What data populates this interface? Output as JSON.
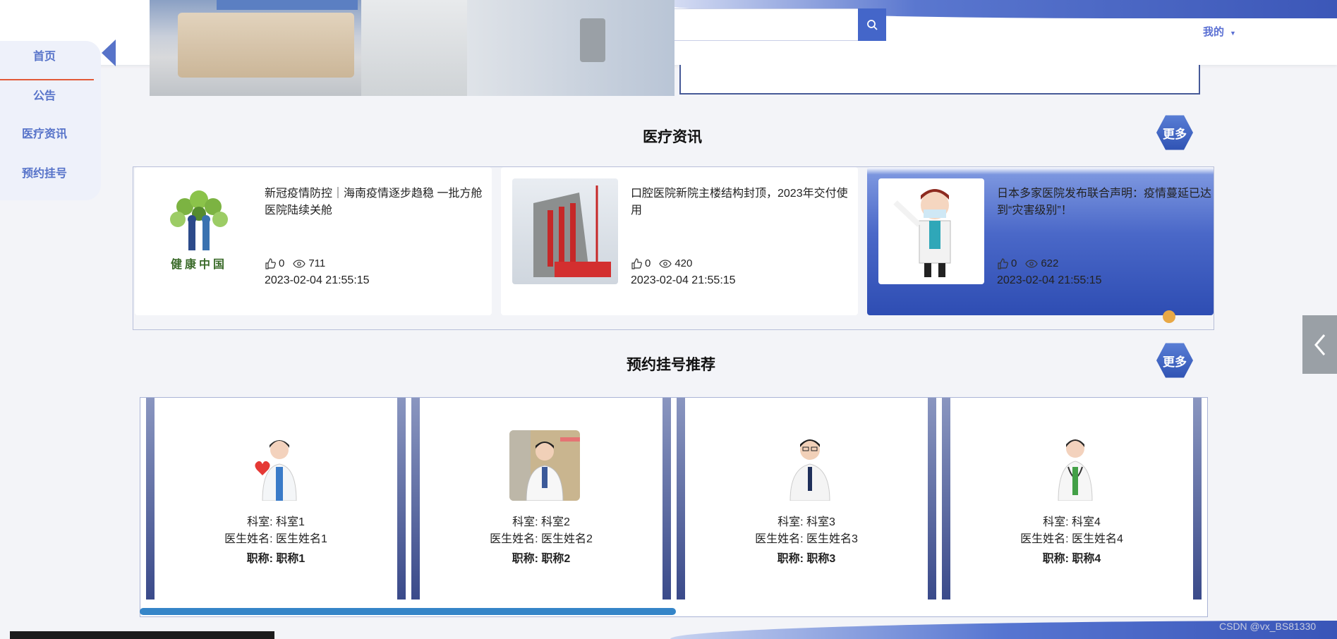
{
  "header": {
    "search_placeholder": "",
    "mine_label": "我的"
  },
  "sidebar": {
    "items": [
      {
        "label": "首页"
      },
      {
        "label": "公告"
      },
      {
        "label": "医疗资讯"
      },
      {
        "label": "预约挂号"
      }
    ]
  },
  "news": {
    "title": "医疗资讯",
    "more_label": "更多",
    "items": [
      {
        "title": "新冠疫情防控｜海南疫情逐步趋稳 一批方舱医院陆续关舱",
        "likes": "0",
        "views": "711",
        "time": "2023-02-04 21:55:15",
        "image_caption": "健康中国"
      },
      {
        "title": "口腔医院新院主楼结构封顶，2023年交付使用",
        "likes": "0",
        "views": "420",
        "time": "2023-02-04 21:55:15"
      },
      {
        "title": "日本多家医院发布联合声明：疫情蔓延已达到“灾害级别”！",
        "likes": "0",
        "views": "622",
        "time": "2023-02-04 21:55:15"
      }
    ]
  },
  "doctors": {
    "title": "预约挂号推荐",
    "more_label": "更多",
    "items": [
      {
        "dept": "科室: 科室1",
        "name": "医生姓名: 医生姓名1",
        "rank": "职称: 职称1"
      },
      {
        "dept": "科室: 科室2",
        "name": "医生姓名: 医生姓名2",
        "rank": "职称: 职称2"
      },
      {
        "dept": "科室: 科室3",
        "name": "医生姓名: 医生姓名3",
        "rank": "职称: 职称3"
      },
      {
        "dept": "科室: 科室4",
        "name": "医生姓名: 医生姓名4",
        "rank": "职称: 职称4"
      }
    ]
  },
  "watermark": "CSDN @vx_BS81330",
  "colors": {
    "accent": "#4466c9",
    "sidebar_text": "#5773c9",
    "underline": "#e25a38"
  }
}
